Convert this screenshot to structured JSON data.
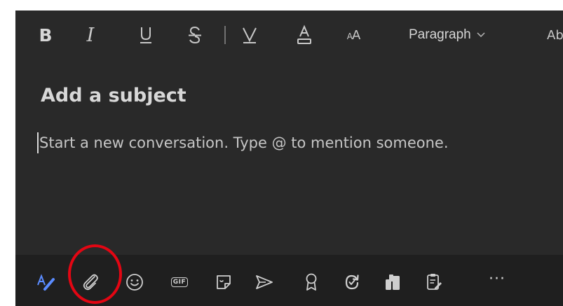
{
  "format_toolbar": {
    "bold_label": "B",
    "italic_label": "I",
    "font_size_label_large": "A",
    "font_size_label_small": "A",
    "paragraph_select": {
      "selected": "Paragraph"
    },
    "overflow_label": "Ab"
  },
  "compose": {
    "subject_placeholder": "Add a subject",
    "message_placeholder": "Start a new conversation. Type @ to mention someone."
  },
  "actions": {
    "gif_label": "GIF",
    "more_label": "···"
  },
  "icons": [
    "bold-icon",
    "italic-icon",
    "underline-icon",
    "strikethrough-icon",
    "highlight-icon",
    "font-color-icon",
    "font-size-icon",
    "chevron-down-icon",
    "format-icon",
    "attach-icon",
    "emoji-icon",
    "gif-icon",
    "sticker-icon",
    "meet-now-icon",
    "praise-icon",
    "loop-icon",
    "approvals-icon",
    "forms-icon",
    "more-options-icon"
  ],
  "colors": {
    "compose_background": "#292929",
    "bottom_bar_background": "#1f1f1f",
    "annotation_ring": "#e30613",
    "format_icon_accent": "#5b8cff"
  }
}
